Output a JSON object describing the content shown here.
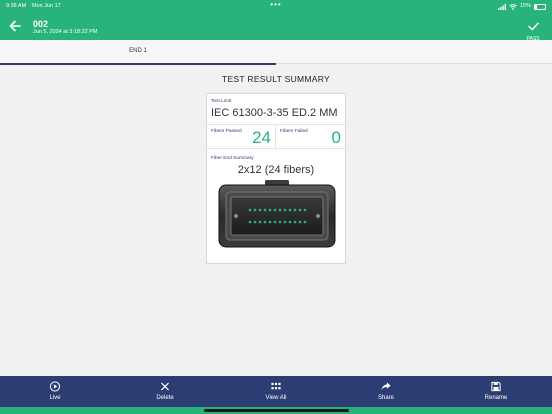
{
  "status_bar": {
    "time": "9:38 AM",
    "date": "Mon Jun 17",
    "battery": "15%",
    "dots": "•••"
  },
  "header": {
    "title": "002",
    "subtitle": "Jun 5, 2024 at 3:18:22 PM",
    "pass_label": "PASS",
    "back_icon": "arrow-left-icon",
    "pass_icon": "checkmark-icon",
    "bg_color": "#27b37a"
  },
  "tabs": [
    {
      "label": "END 1",
      "active": true
    }
  ],
  "summary_title": "TEST RESULT SUMMARY",
  "card": {
    "test_limit_caption": "Test Limit",
    "test_limit_value": "IEC 61300-3-35 ED.2 MM",
    "fibers_passed_caption": "Fibers Passed",
    "fibers_passed_value": "24",
    "fibers_failed_caption": "Fibers Failed",
    "fibers_failed_value": "0",
    "fiber_end_caption": "Fiber End Summary",
    "fiber_end_value": "2x12 (24 fibers)",
    "accent_color": "#27b37a"
  },
  "toolbar": {
    "bg_color": "#2b3d73",
    "items": [
      {
        "label": "Live",
        "icon": "play-circle-icon"
      },
      {
        "label": "Delete",
        "icon": "close-icon"
      },
      {
        "label": "View All",
        "icon": "grid-icon"
      },
      {
        "label": "Share",
        "icon": "share-arrow-icon"
      },
      {
        "label": "Rename",
        "icon": "save-icon"
      }
    ]
  }
}
